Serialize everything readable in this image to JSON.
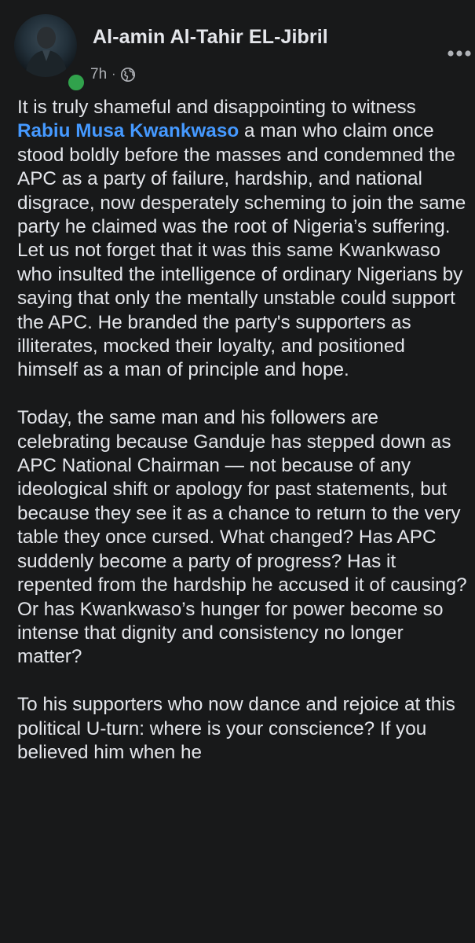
{
  "post": {
    "author_name": "Al-amin Al-Tahir EL-Jibril",
    "time": "7h",
    "separator": "·",
    "privacy_icon": "globe-icon",
    "more_icon": "more-options-icon",
    "online_status_color": "#31a24c",
    "mention_color": "#4599ff",
    "paragraphs": [
      {
        "before": "It is truly shameful and disappointing to witness ",
        "mention": "Rabiu Musa Kwankwaso",
        "after": " a man who claim once stood boldly before the masses and condemned the APC as a party of failure, hardship, and national disgrace, now desperately scheming to join the same party he claimed was the root of Nigeria’s suffering. Let us not forget that it was this same Kwankwaso who insulted the intelligence of ordinary Nigerians by saying that only the mentally unstable could support the APC. He branded the party's supporters as illiterates, mocked their loyalty, and positioned himself as a man of principle and hope."
      },
      {
        "text": "Today, the same man and his followers are celebrating because Ganduje has stepped down as APC National Chairman — not because of any ideological shift or apology for past statements, but because they see it as a chance to return to the very table they once cursed. What changed? Has APC suddenly become a party of progress? Has it repented from the hardship he accused it of causing? Or has Kwankwaso’s hunger for power become so intense that dignity and consistency no longer matter?"
      },
      {
        "text": "To his supporters who now dance and rejoice at this political U-turn: where is your conscience? If you believed him when he"
      }
    ]
  }
}
